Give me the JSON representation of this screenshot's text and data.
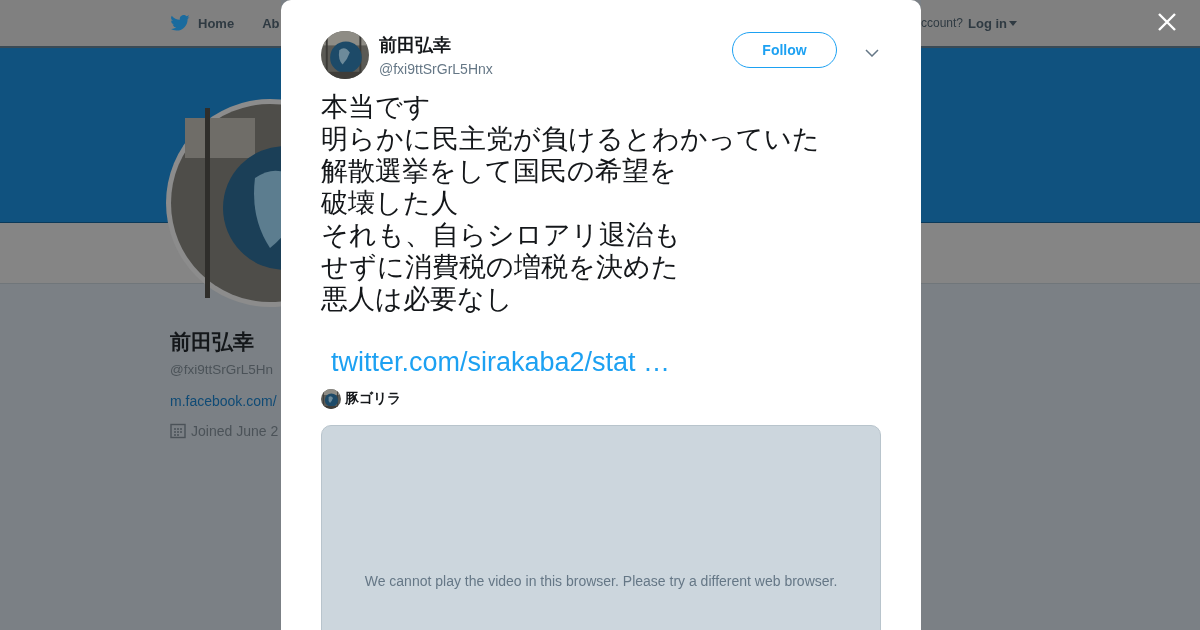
{
  "background_page": {
    "nav": {
      "items": [
        "Home",
        "Ab"
      ],
      "account_prompt": "ccount?",
      "login": "Log in"
    },
    "profile": {
      "name": "前田弘幸",
      "handle": "@fxi9ttSrGrL5Hn",
      "link": "m.facebook.com/",
      "joined": "Joined June 2"
    }
  },
  "tweet": {
    "author": {
      "name": "前田弘幸",
      "handle": "@fxi9ttSrGrL5Hnx"
    },
    "follow_button": "Follow",
    "text_lines": [
      "本当です",
      "明らかに民主党が負けるとわかっていた",
      "解散選挙をして国民の希望を",
      "破壊した人",
      "それも、自らシロアリ退治も",
      "せずに消費税の増税を決めた",
      "悪人は必要なし"
    ],
    "link": "twitter.com/sirakaba2/stat …",
    "quoted_user": "豚ゴリラ",
    "video": {
      "message": "We cannot play the video in this browser. Please try a different web browser."
    }
  }
}
